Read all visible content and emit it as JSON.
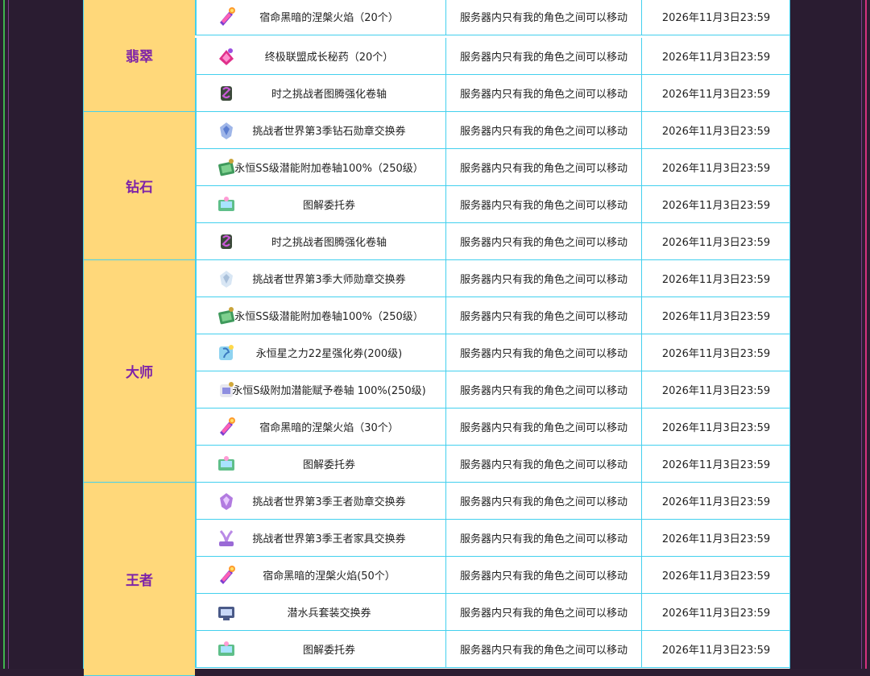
{
  "tiers": [
    {
      "label": "翡翠"
    },
    {
      "label": "钻石"
    },
    {
      "label": "大师"
    },
    {
      "label": "王者"
    }
  ],
  "rows": [
    {
      "icon": "flame-potion-icon",
      "name": "宿命黑暗的涅槃火焰（20个）",
      "trade": "服务器内只有我的角色之间可以移动",
      "expire": "2026年11月3日23:59"
    },
    {
      "icon": "growth-potion-icon",
      "name": "终极联盟成长秘药（20个）",
      "trade": "服务器内只有我的角色之间可以移动",
      "expire": "2026年11月3日23:59"
    },
    {
      "icon": "totem-scroll-icon",
      "name": "时之挑战者图腾强化卷轴",
      "trade": "服务器内只有我的角色之间可以移动",
      "expire": "2026年11月3日23:59"
    },
    {
      "icon": "diamond-medal-icon",
      "name": "挑战者世界第3季钻石勋章交换券",
      "trade": "服务器内只有我的角色之间可以移动",
      "expire": "2026年11月3日23:59"
    },
    {
      "icon": "potential-scroll-icon",
      "name": "永恒SS级潜能附加卷轴100%（250级）",
      "trade": "服务器内只有我的角色之间可以移动",
      "expire": "2026年11月3日23:59"
    },
    {
      "icon": "codex-ticket-icon",
      "name": "图解委托券",
      "trade": "服务器内只有我的角色之间可以移动",
      "expire": "2026年11月3日23:59"
    },
    {
      "icon": "totem-scroll-icon",
      "name": "时之挑战者图腾强化卷轴",
      "trade": "服务器内只有我的角色之间可以移动",
      "expire": "2026年11月3日23:59"
    },
    {
      "icon": "master-medal-icon",
      "name": "挑战者世界第3季大师勋章交换券",
      "trade": "服务器内只有我的角色之间可以移动",
      "expire": "2026年11月3日23:59"
    },
    {
      "icon": "potential-scroll-icon",
      "name": "永恒SS级潜能附加卷轴100%（250级）",
      "trade": "服务器内只有我的角色之间可以移动",
      "expire": "2026年11月3日23:59"
    },
    {
      "icon": "starforce-scroll-icon",
      "name": "永恒星之力22星强化券(200级)",
      "trade": "服务器内只有我的角色之间可以移动",
      "expire": "2026年11月3日23:59"
    },
    {
      "icon": "potential-grant-scroll-icon",
      "name": "永恒S级附加潜能赋予卷轴 100%(250级)",
      "trade": "服务器内只有我的角色之间可以移动",
      "expire": "2026年11月3日23:59"
    },
    {
      "icon": "flame-potion-icon",
      "name": "宿命黑暗的涅槃火焰（30个）",
      "trade": "服务器内只有我的角色之间可以移动",
      "expire": "2026年11月3日23:59"
    },
    {
      "icon": "codex-ticket-icon",
      "name": "图解委托券",
      "trade": "服务器内只有我的角色之间可以移动",
      "expire": "2026年11月3日23:59"
    },
    {
      "icon": "champion-medal-icon",
      "name": "挑战者世界第3季王者勋章交换券",
      "trade": "服务器内只有我的角色之间可以移动",
      "expire": "2026年11月3日23:59"
    },
    {
      "icon": "furniture-ticket-icon",
      "name": "挑战者世界第3季王者家具交换券",
      "trade": "服务器内只有我的角色之间可以移动",
      "expire": "2026年11月3日23:59"
    },
    {
      "icon": "flame-potion-icon",
      "name": "宿命黑暗的涅槃火焰(50个）",
      "trade": "服务器内只有我的角色之间可以移动",
      "expire": "2026年11月3日23:59"
    },
    {
      "icon": "diver-set-ticket-icon",
      "name": "潜水兵套装交换券",
      "trade": "服务器内只有我的角色之间可以移动",
      "expire": "2026年11月3日23:59"
    },
    {
      "icon": "codex-ticket-icon",
      "name": "图解委托券",
      "trade": "服务器内只有我的角色之间可以移动",
      "expire": "2026年11月3日23:59"
    }
  ]
}
